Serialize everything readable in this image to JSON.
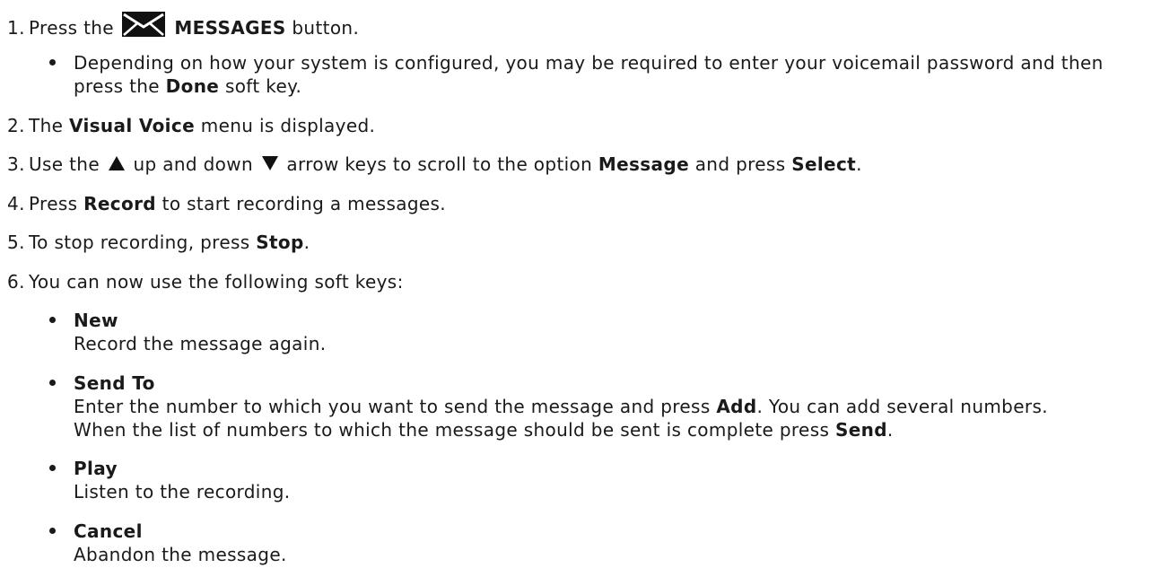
{
  "steps": [
    {
      "num": "1.",
      "pre": "Press the",
      "bold": "MESSAGES",
      "post": "button."
    },
    {
      "num": "2.",
      "pre": "The",
      "bold": "Visual Voice",
      "post": "menu is displayed."
    },
    {
      "num": "3.",
      "pre": "Use the",
      "mid1": "up and down",
      "mid2": "arrow keys to scroll to the option",
      "bold1": "Message",
      "mid3": "and press",
      "bold2": "Select",
      "post": "."
    },
    {
      "num": "4.",
      "pre": "Press",
      "bold": "Record",
      "post": "to start recording a messages."
    },
    {
      "num": "5.",
      "pre": "To stop recording, press",
      "bold": "Stop",
      "post": "."
    },
    {
      "num": "6.",
      "text": "You can now use the following soft keys:"
    }
  ],
  "step1_note": {
    "line1": "Depending on how your system is configured, you may be required to enter your voicemail password and then",
    "line2_pre": "press the",
    "line2_bold": "Done",
    "line2_post": "soft key."
  },
  "soft_keys": [
    {
      "name": "New",
      "desc": "Record the message again."
    },
    {
      "name": "Send To",
      "desc1_pre": "Enter the number to which you want to send the message and press",
      "desc1_bold": "Add",
      "desc1_post": ". You can add several numbers.",
      "desc2_pre": "When the list of numbers to which the message should be sent is complete press",
      "desc2_bold": "Send",
      "desc2_post": "."
    },
    {
      "name": "Play",
      "desc": "Listen to the recording."
    },
    {
      "name": "Cancel",
      "desc": "Abandon the message."
    }
  ],
  "icons": {
    "messages": "envelope-icon",
    "up": "up-arrow-icon",
    "down": "down-arrow-icon"
  }
}
